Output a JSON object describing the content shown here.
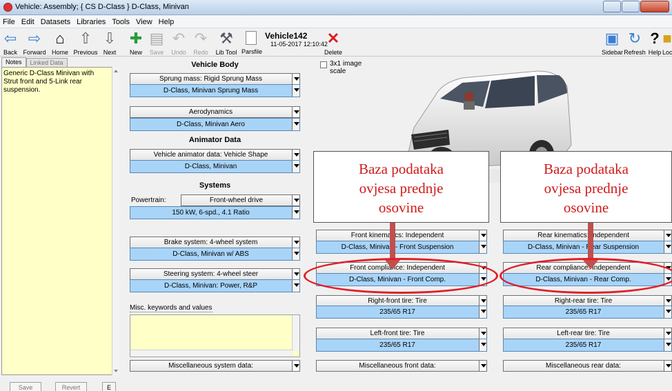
{
  "window": {
    "title": "Vehicle: Assembly;  { CS D-Class }  D-Class, Minivan"
  },
  "menu": [
    "File",
    "Edit",
    "Datasets",
    "Libraries",
    "Tools",
    "View",
    "Help"
  ],
  "toolbar": {
    "back": "Back",
    "forward": "Forward",
    "home": "Home",
    "previous": "Previous",
    "next": "Next",
    "new": "New",
    "save": "Save",
    "undo": "Undo",
    "redo": "Redo",
    "lib_tool": "Lib Tool",
    "parsfile": "Parsfile",
    "delete": "Delete",
    "sidebar": "Sidebar",
    "refresh": "Refresh",
    "help": "Help",
    "lock": "Loc",
    "dataset_name": "Vehicle142",
    "dataset_date": "11-05-2017 12:10:42"
  },
  "notes": {
    "tab_notes": "Notes",
    "tab_linked": "Linked Data",
    "text": "Generic D-Class Minivan with Strut front and 5-Link rear suspension.",
    "save": "Save",
    "revert": "Revert",
    "extra": "E"
  },
  "vehicle_body": {
    "header": "Vehicle Body",
    "sprung_mass_label": "Sprung mass: Rigid Sprung Mass",
    "sprung_mass_value": "D-Class, Minivan Sprung Mass",
    "aero_label": "Aerodynamics",
    "aero_value": "D-Class, Minivan Aero"
  },
  "animator": {
    "header": "Animator Data",
    "shape_label": "Vehicle animator data: Vehicle Shape",
    "shape_value": "D-Class, Minivan"
  },
  "systems": {
    "header": "Systems",
    "powertrain_label": "Powertrain:",
    "powertrain_type": "Front-wheel drive",
    "powertrain_value": "150 kW, 6-spd., 4.1 Ratio",
    "brake_label": "Brake system: 4-wheel system",
    "brake_value": "D-Class, Minivan w/ ABS",
    "steering_label": "Steering system: 4-wheel steer",
    "steering_value": "D-Class, Minivan: Power, R&P",
    "misc_keywords": "Misc. keywords and values",
    "misc_system": "Miscellaneous system data:"
  },
  "image_option": {
    "checkbox_label": "3x1 image scale"
  },
  "front": {
    "kinematics_label": "Front kinematics: Independent",
    "kinematics_value": "D-Class, Minivan - Front Suspension",
    "compliance_label": "Front compliance: Independent",
    "compliance_value": "D-Class, Minivan - Front Comp.",
    "right_tire_label": "Right-front tire: Tire",
    "right_tire_value": "235/65 R17",
    "left_tire_label": "Left-front tire: Tire",
    "left_tire_value": "235/65 R17",
    "misc": "Miscellaneous front data:"
  },
  "rear": {
    "kinematics_label": "Rear kinematics: Independent",
    "kinematics_value": "D-Class, Minivan - Rear Suspension",
    "compliance_label": "Rear compliance: Independent",
    "compliance_value": "D-Class, Minivan - Rear Comp.",
    "right_tire_label": "Right-rear tire: Tire",
    "right_tire_value": "235/65 R17",
    "left_tire_label": "Left-rear tire: Tire",
    "left_tire_value": "235/65 R17",
    "misc": "Miscellaneous rear data:"
  },
  "annotations": {
    "front_callout": [
      "Baza podataka",
      "ovjesa prednje",
      "osovine"
    ],
    "rear_callout": [
      "Baza podataka",
      "ovjesa prednje",
      "osovine"
    ],
    "color": "#d01a1a"
  }
}
